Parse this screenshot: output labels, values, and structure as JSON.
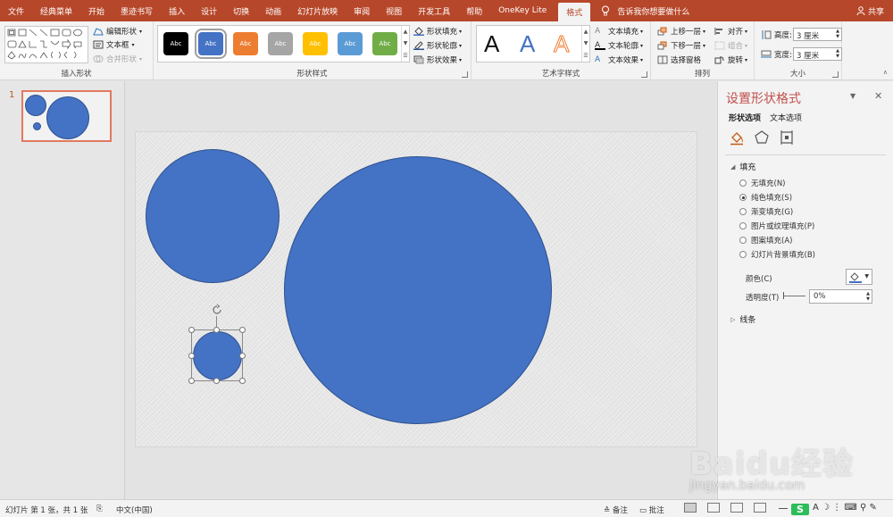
{
  "tabs": [
    "文件",
    "经典菜单",
    "开始",
    "墨迹书写",
    "插入",
    "设计",
    "切换",
    "动画",
    "幻灯片放映",
    "审阅",
    "视图",
    "开发工具",
    "帮助",
    "OneKey Lite",
    "格式"
  ],
  "active_tab": "格式",
  "tell_me": "告诉我你想要做什么",
  "share": "共享",
  "ribbon": {
    "insert_shapes": {
      "label": "插入形状",
      "edit_shape": "编辑形状",
      "text_box": "文本框",
      "merge_shapes": "合并形状"
    },
    "shape_styles": {
      "label": "形状样式",
      "swatch_text": "Abc",
      "swatch_colors": [
        "#000000",
        "#4472c4",
        "#ed7d31",
        "#a5a5a5",
        "#ffc000",
        "#5b9bd5",
        "#70ad47"
      ],
      "shape_fill": "形状填充",
      "shape_outline": "形状轮廓",
      "shape_effects": "形状效果"
    },
    "wordart_styles": {
      "label": "艺术字样式",
      "letter": "A",
      "text_fill": "文本填充",
      "text_outline": "文本轮廓",
      "text_effects": "文本效果"
    },
    "arrange": {
      "label": "排列",
      "bring_forward": "上移一层",
      "send_backward": "下移一层",
      "selection_pane": "选择窗格",
      "align": "对齐",
      "group": "组合",
      "rotate": "旋转"
    },
    "size": {
      "label": "大小",
      "height_label": "高度:",
      "height_value": "3 厘米",
      "width_label": "宽度:",
      "width_value": "3 厘米"
    }
  },
  "thumbnail": {
    "number": "1"
  },
  "format_pane": {
    "title": "设置形状格式",
    "tab_shape": "形状选项",
    "tab_text": "文本选项",
    "fill_section": "填充",
    "fill_options": [
      "无填充(N)",
      "纯色填充(S)",
      "渐变填充(G)",
      "图片或纹理填充(P)",
      "图案填充(A)",
      "幻灯片背景填充(B)"
    ],
    "selected_fill": "纯色填充(S)",
    "color_label": "颜色(C)",
    "transparency_label": "透明度(T)",
    "transparency_value": "0%",
    "line_section": "线条"
  },
  "status_bar": {
    "slide_info": "幻灯片 第 1 张，共 1 张",
    "language": "中文(中国)",
    "notes": "备注",
    "comments": "批注"
  },
  "watermark": {
    "logo": "Baidu经验",
    "url": "jingyan.baidu.com"
  },
  "colors": {
    "accent": "#b7472a",
    "shape_fill": "#4472c4",
    "pane_title": "#c0504d"
  }
}
